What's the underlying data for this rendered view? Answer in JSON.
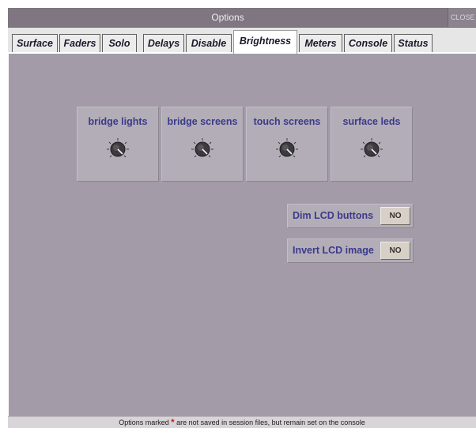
{
  "window": {
    "title": "Options",
    "close_label": "CLOSE"
  },
  "tabs": [
    {
      "label": "Surface"
    },
    {
      "label": "Faders"
    },
    {
      "label": "Solo"
    },
    {
      "label": "Delays"
    },
    {
      "label": "Disable"
    },
    {
      "label": "Brightness",
      "active": true
    },
    {
      "label": "Meters"
    },
    {
      "label": "Console"
    },
    {
      "label": "Status"
    }
  ],
  "brightness": {
    "knobs": [
      {
        "label": "bridge lights",
        "icon": "knob-icon"
      },
      {
        "label": "bridge screens",
        "icon": "knob-icon"
      },
      {
        "label": "touch screens",
        "icon": "knob-icon"
      },
      {
        "label": "surface leds",
        "icon": "knob-icon"
      }
    ],
    "options": [
      {
        "label": "Dim LCD buttons",
        "value": "NO"
      },
      {
        "label": "Invert LCD image",
        "value": "NO"
      }
    ]
  },
  "status": {
    "msg_before": "Options marked",
    "star": "*",
    "msg_after": "are not saved in session files, but remain set on the console"
  },
  "colors": {
    "panel_bg": "#a39ca8",
    "label_text": "#3b3a8a",
    "titlebar_bg": "#7f7681",
    "star_red": "#cc1111"
  }
}
